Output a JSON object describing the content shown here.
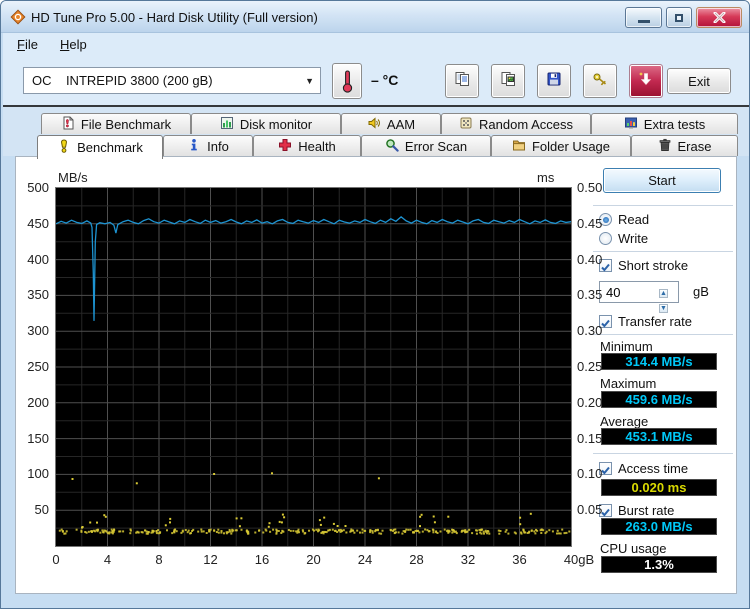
{
  "window": {
    "title": "HD Tune Pro 5.00 - Hard Disk Utility (Full version)",
    "app_icon": "hdtune-logo-icon",
    "buttons": [
      "minimize",
      "maximize",
      "close"
    ]
  },
  "menu": {
    "items": [
      {
        "label": "File",
        "underline": 0
      },
      {
        "label": "Help",
        "underline": 0
      }
    ]
  },
  "toolbar": {
    "drive_select": {
      "value": "OC    INTREPID 3800 (200 gB)",
      "icon": "chevron-down-icon"
    },
    "temperature": {
      "icon": "thermometer-icon",
      "label": "– °C"
    },
    "buttons": [
      {
        "name": "copy-text-button",
        "icon": "copy-icon"
      },
      {
        "name": "copy-image-button",
        "icon": "copy-image-icon"
      },
      {
        "name": "save-button",
        "icon": "save-icon"
      },
      {
        "name": "options-button",
        "icon": "keys-icon"
      },
      {
        "name": "update-button",
        "icon": "down-arrow-icon"
      }
    ],
    "exit_label": "Exit"
  },
  "tabs": {
    "row1": [
      {
        "label": "File Benchmark",
        "icon": "page-exclamation-icon",
        "active": false
      },
      {
        "label": "Disk monitor",
        "icon": "bar-chart-icon",
        "active": false
      },
      {
        "label": "AAM",
        "icon": "speaker-icon",
        "active": false
      },
      {
        "label": "Random Access",
        "icon": "dice-icon",
        "active": false
      },
      {
        "label": "Extra tests",
        "icon": "mini-chart-icon",
        "active": false
      }
    ],
    "row2": [
      {
        "label": "Benchmark",
        "icon": "exclamation-icon",
        "active": true
      },
      {
        "label": "Info",
        "icon": "info-icon",
        "active": false
      },
      {
        "label": "Health",
        "icon": "health-cross-icon",
        "active": false
      },
      {
        "label": "Error Scan",
        "icon": "magnifier-icon",
        "active": false
      },
      {
        "label": "Folder Usage",
        "icon": "folder-icon",
        "active": false
      },
      {
        "label": "Erase",
        "icon": "trash-icon",
        "active": false
      }
    ]
  },
  "controls": {
    "start_label": "Start",
    "read_label": "Read",
    "write_label": "Write",
    "read_selected": true,
    "short_stroke": {
      "label": "Short stroke",
      "checked": true
    },
    "capacity": {
      "value": "40",
      "unit": "gB"
    },
    "transfer_rate": {
      "label": "Transfer rate",
      "checked": true
    },
    "minimum": {
      "label": "Minimum",
      "value": "314.4 MB/s"
    },
    "maximum": {
      "label": "Maximum",
      "value": "459.6 MB/s"
    },
    "average": {
      "label": "Average",
      "value": "453.1 MB/s"
    },
    "access_time": {
      "label": "Access time",
      "value": "0.020 ms",
      "checked": true
    },
    "burst_rate": {
      "label": "Burst rate",
      "value": "263.0 MB/s",
      "checked": true
    },
    "cpu_usage": {
      "label": "CPU usage",
      "value": "1.3%"
    }
  },
  "chart_data": {
    "type": "line",
    "title": "",
    "left_axis": {
      "label": "MB/s",
      "min": 0,
      "max": 500,
      "ticks": [
        500,
        450,
        400,
        350,
        300,
        250,
        200,
        150,
        100,
        50
      ],
      "minor_step": 25
    },
    "right_axis": {
      "label": "ms",
      "min": 0,
      "max": 0.5,
      "ticks": [
        "0.50",
        "0.45",
        "0.40",
        "0.35",
        "0.30",
        "0.25",
        "0.20",
        "0.15",
        "0.10",
        "0.05"
      ]
    },
    "x_axis": {
      "min": 0,
      "max": 40,
      "tick_values": [
        0,
        4,
        8,
        12,
        16,
        20,
        24,
        28,
        32,
        36,
        40
      ],
      "tick_labels": [
        "0",
        "4",
        "8",
        "12",
        "16",
        "20",
        "24",
        "28",
        "32",
        "36",
        "40gB"
      ],
      "minor_step": 2
    },
    "colors": {
      "background": "#000000",
      "grid_minor": "#262626",
      "grid_major": "#4f4f4f",
      "border": "#757575",
      "transfer_line": "#1d93d1",
      "access_dots": "#d9ca35"
    },
    "series": [
      {
        "name": "transfer_rate_mbs",
        "type": "line",
        "points": [
          [
            0,
            450
          ],
          [
            0.4,
            453.5
          ],
          [
            0.8,
            451
          ],
          [
            1.2,
            455
          ],
          [
            1.6,
            452
          ],
          [
            2.0,
            450.5
          ],
          [
            2.4,
            454
          ],
          [
            2.7,
            451
          ],
          [
            2.8,
            445
          ],
          [
            2.9,
            381
          ],
          [
            2.95,
            314.4
          ],
          [
            3.05,
            425
          ],
          [
            3.15,
            449
          ],
          [
            3.4,
            451.5
          ],
          [
            3.8,
            450
          ],
          [
            4.2,
            452
          ],
          [
            4.5,
            448
          ],
          [
            4.65,
            437
          ],
          [
            4.8,
            449
          ],
          [
            5.2,
            453
          ],
          [
            5.6,
            455
          ],
          [
            6.0,
            452
          ],
          [
            6.4,
            450
          ],
          [
            6.8,
            454.5
          ],
          [
            7.2,
            457
          ],
          [
            7.6,
            453
          ],
          [
            8.0,
            451
          ],
          [
            8.4,
            455
          ],
          [
            8.8,
            452.5
          ],
          [
            9.2,
            450
          ],
          [
            9.6,
            454
          ],
          [
            10.0,
            452
          ],
          [
            10.4,
            456
          ],
          [
            10.8,
            453
          ],
          [
            11.2,
            450.5
          ],
          [
            11.6,
            455
          ],
          [
            12.0,
            452
          ],
          [
            12.4,
            454.5
          ],
          [
            12.8,
            451
          ],
          [
            13.2,
            453
          ],
          [
            13.6,
            456
          ],
          [
            14.0,
            452.5
          ],
          [
            14.4,
            450
          ],
          [
            14.8,
            454
          ],
          [
            15.2,
            452
          ],
          [
            15.6,
            455.5
          ],
          [
            16.0,
            451
          ],
          [
            16.4,
            453
          ],
          [
            16.8,
            450
          ],
          [
            17.2,
            454
          ],
          [
            17.6,
            456
          ],
          [
            18.0,
            452
          ],
          [
            18.4,
            450.5
          ],
          [
            18.8,
            455
          ],
          [
            19.2,
            453
          ],
          [
            19.6,
            451
          ],
          [
            20.0,
            454.5
          ],
          [
            20.4,
            452
          ],
          [
            20.8,
            456
          ],
          [
            21.2,
            453
          ],
          [
            21.6,
            450
          ],
          [
            22.0,
            455
          ],
          [
            22.4,
            452.5
          ],
          [
            22.8,
            451
          ],
          [
            23.2,
            454
          ],
          [
            23.6,
            452
          ],
          [
            24.0,
            456
          ],
          [
            24.4,
            453
          ],
          [
            24.8,
            450.5
          ],
          [
            25.2,
            455
          ],
          [
            25.6,
            452
          ],
          [
            26.0,
            457
          ],
          [
            26.4,
            453.5
          ],
          [
            26.8,
            459.6
          ],
          [
            27.2,
            454
          ],
          [
            27.6,
            451
          ],
          [
            28.0,
            455
          ],
          [
            28.4,
            452
          ],
          [
            28.8,
            450
          ],
          [
            29.2,
            454.5
          ],
          [
            29.6,
            452
          ],
          [
            30.0,
            456
          ],
          [
            30.4,
            453
          ],
          [
            30.8,
            451
          ],
          [
            31.2,
            455
          ],
          [
            31.6,
            452.5
          ],
          [
            32.0,
            450
          ],
          [
            32.4,
            454
          ],
          [
            32.8,
            456
          ],
          [
            33.2,
            452
          ],
          [
            33.6,
            450.5
          ],
          [
            34.0,
            455
          ],
          [
            34.4,
            453
          ],
          [
            34.8,
            451
          ],
          [
            35.2,
            454.5
          ],
          [
            35.6,
            452
          ],
          [
            36.0,
            456
          ],
          [
            36.4,
            453
          ],
          [
            36.8,
            450
          ],
          [
            37.2,
            454
          ],
          [
            37.6,
            452
          ],
          [
            38.0,
            455.5
          ],
          [
            38.4,
            452
          ],
          [
            38.8,
            450.5
          ],
          [
            39.2,
            454
          ],
          [
            39.6,
            452
          ],
          [
            40.0,
            453
          ]
        ]
      },
      {
        "name": "access_time_ms",
        "type": "scatter",
        "dense_band": {
          "count": 330,
          "x_min": 0.2,
          "x_max": 39.8,
          "ms_min": 0.0185,
          "ms_max": 0.0245,
          "seed": 7
        },
        "mid_scatter": {
          "cluster_centers": [
            2.5,
            3.6,
            8.7,
            14.4,
            17.0,
            17.8,
            21.0,
            21.9,
            28.6,
            29.8,
            36.4
          ],
          "dots_per_cluster": 3,
          "spread": 0.6,
          "ms_min": 0.027,
          "ms_max": 0.047,
          "seed": 13
        },
        "outliers": [
          [
            1.2,
            0.095
          ],
          [
            6.2,
            0.089
          ],
          [
            12.2,
            0.102
          ],
          [
            16.7,
            0.103
          ],
          [
            25.0,
            0.096
          ]
        ]
      }
    ]
  }
}
